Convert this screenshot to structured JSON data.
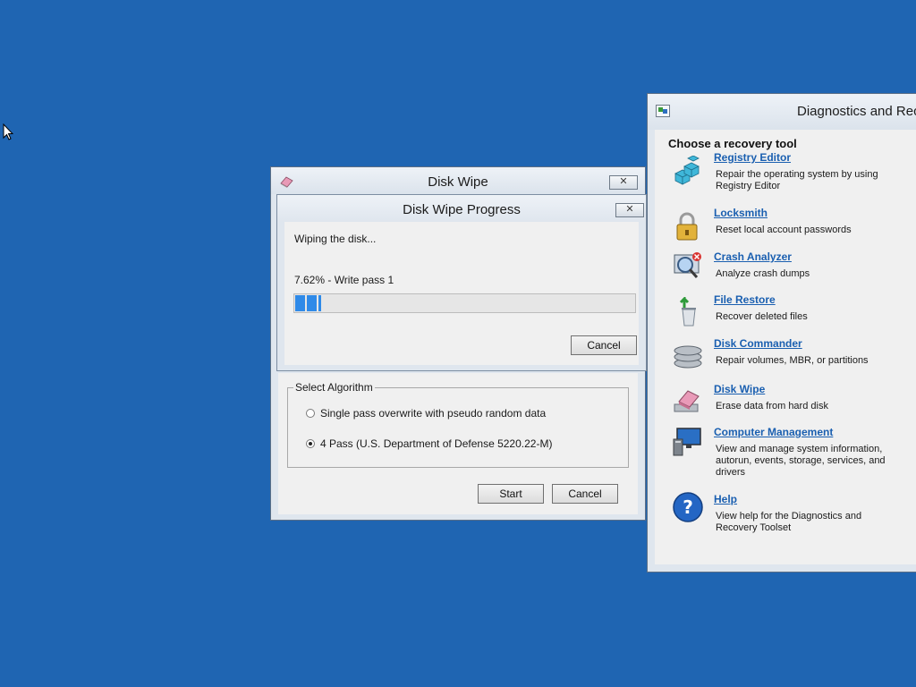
{
  "diag_window": {
    "title": "Diagnostics and Rec",
    "heading": "Choose a recovery tool",
    "tools": [
      {
        "name": "Registry Editor",
        "description": "Repair the operating system by using Registry Editor",
        "icon": "registry-icon"
      },
      {
        "name": "Locksmith",
        "description": "Reset local account passwords",
        "icon": "padlock-icon"
      },
      {
        "name": "Crash Analyzer",
        "description": "Analyze crash dumps",
        "icon": "crash-analyzer-icon"
      },
      {
        "name": "File Restore",
        "description": "Recover deleted files",
        "icon": "file-restore-icon"
      },
      {
        "name": "Disk Commander",
        "description": "Repair volumes, MBR, or partitions",
        "icon": "disk-stack-icon"
      },
      {
        "name": "Disk Wipe",
        "description": "Erase data from hard disk",
        "icon": "eraser-icon"
      },
      {
        "name": "Computer Management",
        "description": "View and manage system information, autorun, events, storage, services, and drivers",
        "icon": "computer-management-icon"
      },
      {
        "name": "Help",
        "description": "View help for the Diagnostics and Recovery Toolset",
        "icon": "help-icon"
      }
    ]
  },
  "disk_wipe": {
    "title": "Disk Wipe",
    "close_label": "✕",
    "algorithm_label": "Select Algorithm",
    "options": [
      {
        "label": "Single pass overwrite with pseudo random data",
        "selected": false
      },
      {
        "label": "4 Pass (U.S. Department of Defense 5220.22-M)",
        "selected": true
      }
    ],
    "start_label": "Start",
    "cancel_label": "Cancel"
  },
  "progress": {
    "title": "Disk Wipe Progress",
    "close_label": "✕",
    "status": "Wiping the disk...",
    "detail": "7.62% - Write pass 1",
    "fraction": 0.0762,
    "cancel_label": "Cancel"
  },
  "colors": {
    "desktop": "#1f65b2",
    "progress_fill": "#2f8ae8",
    "link": "#1a5fb0"
  }
}
